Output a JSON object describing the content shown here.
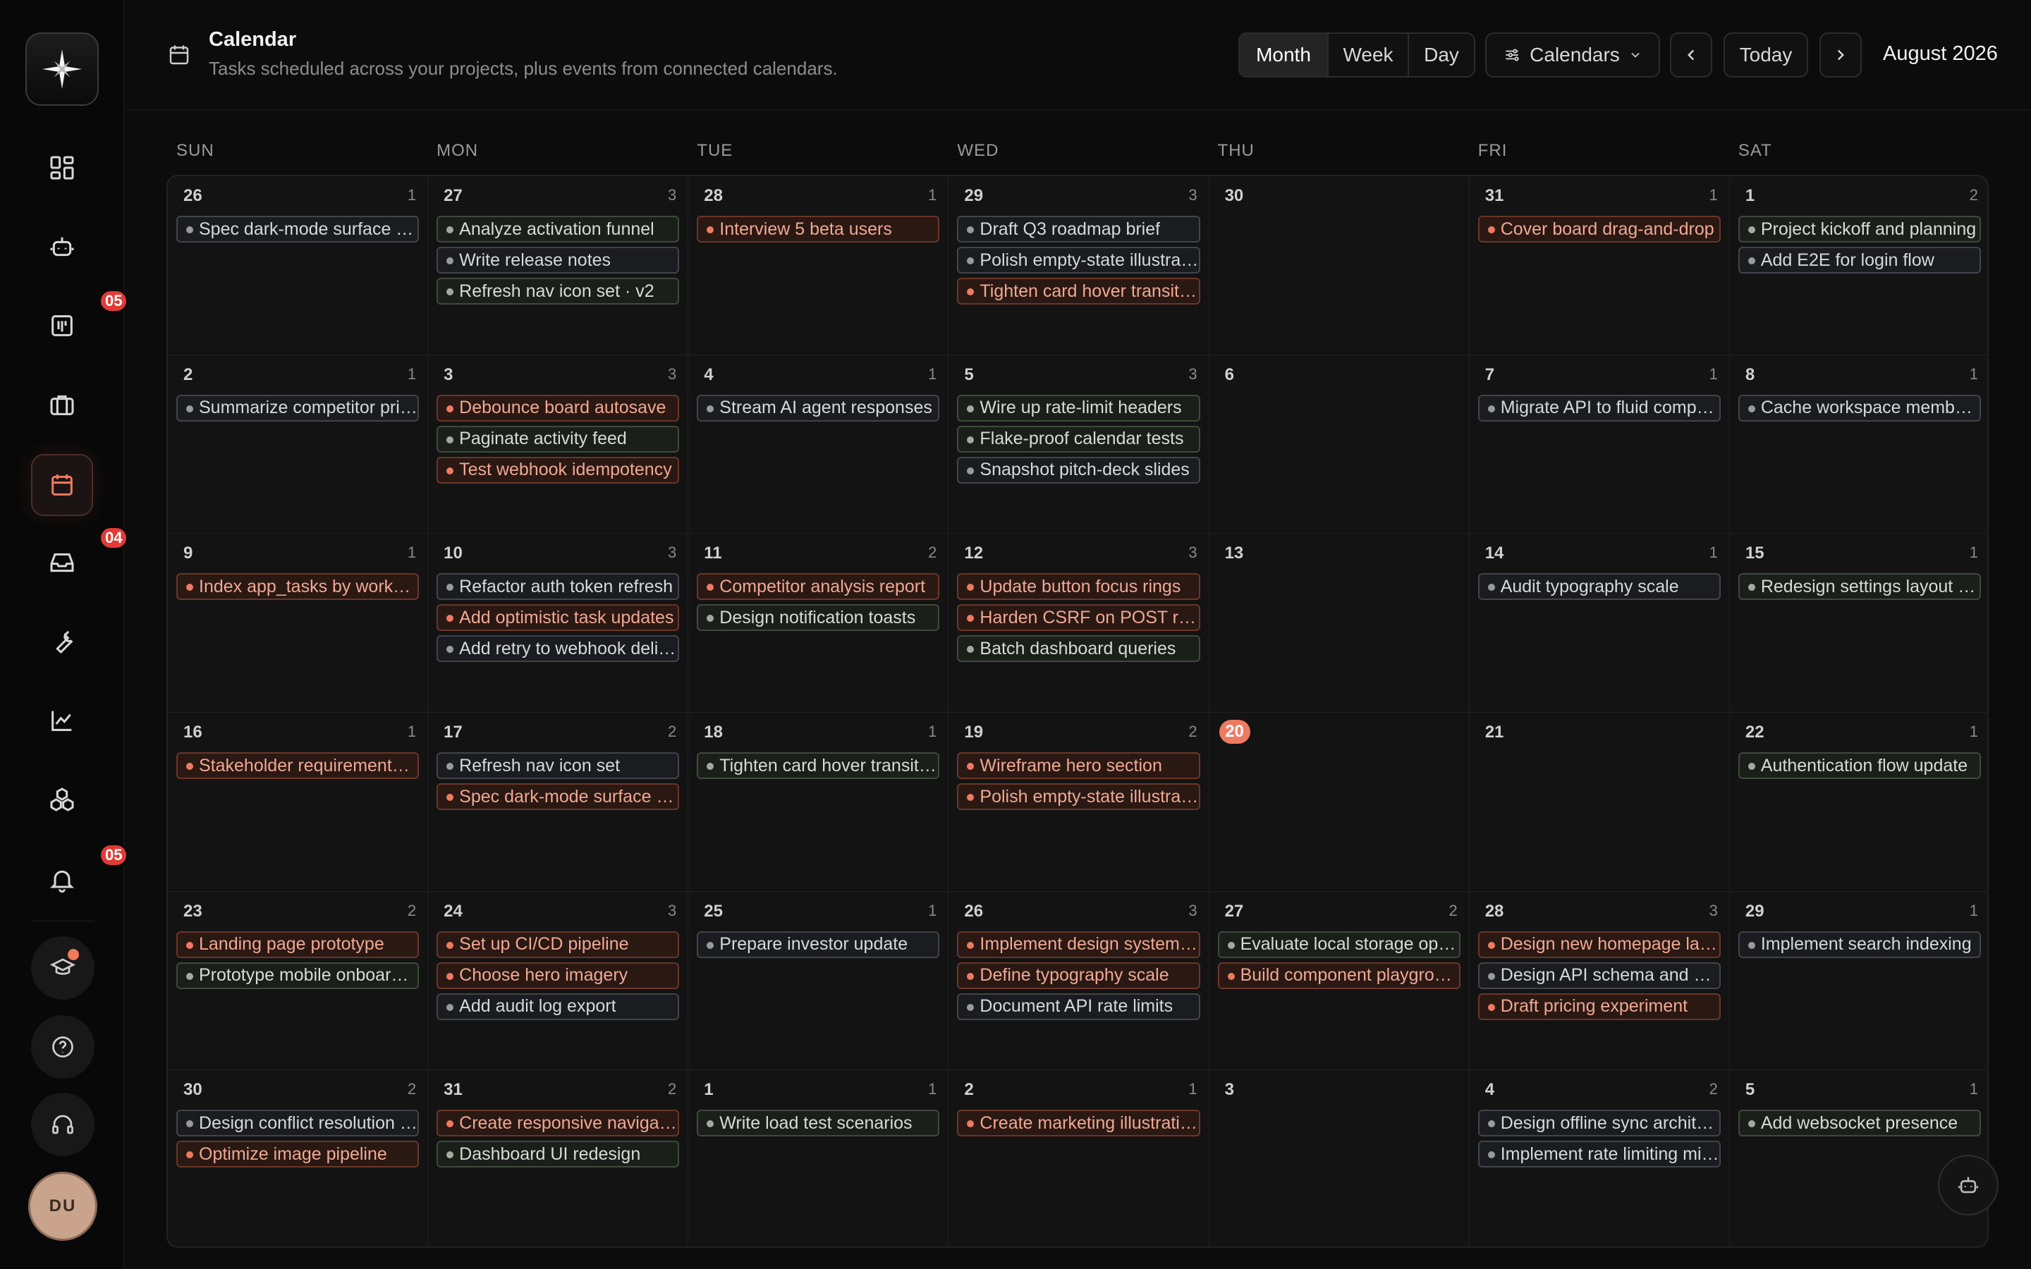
{
  "sidebar": {
    "logo_icon": "sparkle-logo-icon",
    "items": [
      {
        "name": "dashboard",
        "icon": "grid-icon",
        "badge": ""
      },
      {
        "name": "agents",
        "icon": "bot-icon",
        "badge": ""
      },
      {
        "name": "boards",
        "icon": "kanban-icon",
        "badge": "05"
      },
      {
        "name": "projects",
        "icon": "briefcase-icon",
        "badge": ""
      },
      {
        "name": "calendar",
        "icon": "calendar-icon",
        "badge": "",
        "active": true
      },
      {
        "name": "inbox",
        "icon": "inbox-icon",
        "badge": "04"
      },
      {
        "name": "tools",
        "icon": "wrench-icon",
        "badge": ""
      },
      {
        "name": "analytics",
        "icon": "chart-icon",
        "badge": ""
      },
      {
        "name": "integrations",
        "icon": "cubes-icon",
        "badge": ""
      },
      {
        "name": "notifications",
        "icon": "bell-icon",
        "badge": "05"
      }
    ],
    "avatar_initials": "DU"
  },
  "header": {
    "title": "Calendar",
    "subtitle": "Tasks scheduled across your projects, plus events from connected calendars.",
    "views": [
      "Month",
      "Week",
      "Day"
    ],
    "active_view": "Month",
    "calendars_label": "Calendars",
    "today_label": "Today",
    "month_label": "August 2026"
  },
  "weekdays": [
    "SUN",
    "MON",
    "TUE",
    "WED",
    "THU",
    "FRI",
    "SAT"
  ],
  "weeks": [
    [
      {
        "day": "26",
        "count": "1",
        "events": [
          {
            "t": "Spec dark-mode surface tokens",
            "c": "gray"
          }
        ]
      },
      {
        "day": "27",
        "count": "3",
        "events": [
          {
            "t": "Analyze activation funnel",
            "c": "green"
          },
          {
            "t": "Write release notes",
            "c": "gray"
          },
          {
            "t": "Refresh nav icon set · v2",
            "c": "green"
          }
        ]
      },
      {
        "day": "28",
        "count": "1",
        "events": [
          {
            "t": "Interview 5 beta users",
            "c": "red"
          }
        ]
      },
      {
        "day": "29",
        "count": "3",
        "events": [
          {
            "t": "Draft Q3 roadmap brief",
            "c": "gray"
          },
          {
            "t": "Polish empty-state illustrations",
            "c": "gray"
          },
          {
            "t": "Tighten card hover transitions",
            "c": "red"
          }
        ]
      },
      {
        "day": "30",
        "count": "",
        "events": []
      },
      {
        "day": "31",
        "count": "1",
        "events": [
          {
            "t": "Cover board drag-and-drop",
            "c": "red"
          }
        ]
      },
      {
        "day": "1",
        "count": "2",
        "events": [
          {
            "t": "Project kickoff and planning",
            "c": "green"
          },
          {
            "t": "Add E2E for login flow",
            "c": "gray"
          }
        ]
      }
    ],
    [
      {
        "day": "2",
        "count": "1",
        "events": [
          {
            "t": "Summarize competitor pricing",
            "c": "gray"
          }
        ]
      },
      {
        "day": "3",
        "count": "3",
        "events": [
          {
            "t": "Debounce board autosave",
            "c": "red"
          },
          {
            "t": "Paginate activity feed",
            "c": "green"
          },
          {
            "t": "Test webhook idempotency",
            "c": "red"
          }
        ]
      },
      {
        "day": "4",
        "count": "1",
        "events": [
          {
            "t": "Stream AI agent responses",
            "c": "gray"
          }
        ]
      },
      {
        "day": "5",
        "count": "3",
        "events": [
          {
            "t": "Wire up rate-limit headers",
            "c": "green"
          },
          {
            "t": "Flake-proof calendar tests",
            "c": "green"
          },
          {
            "t": "Snapshot pitch-deck slides",
            "c": "gray"
          }
        ]
      },
      {
        "day": "6",
        "count": "",
        "events": []
      },
      {
        "day": "7",
        "count": "1",
        "events": [
          {
            "t": "Migrate API to fluid compute",
            "c": "gray"
          }
        ]
      },
      {
        "day": "8",
        "count": "1",
        "events": [
          {
            "t": "Cache workspace member list",
            "c": "gray"
          }
        ]
      }
    ],
    [
      {
        "day": "9",
        "count": "1",
        "events": [
          {
            "t": "Index app_tasks by workspace",
            "c": "red"
          }
        ]
      },
      {
        "day": "10",
        "count": "3",
        "events": [
          {
            "t": "Refactor auth token refresh",
            "c": "gray"
          },
          {
            "t": "Add optimistic task updates",
            "c": "red"
          },
          {
            "t": "Add retry to webhook delivery",
            "c": "gray"
          }
        ]
      },
      {
        "day": "11",
        "count": "2",
        "events": [
          {
            "t": "Competitor analysis report",
            "c": "red"
          },
          {
            "t": "Design notification toasts",
            "c": "green"
          }
        ]
      },
      {
        "day": "12",
        "count": "3",
        "events": [
          {
            "t": "Update button focus rings",
            "c": "red"
          },
          {
            "t": "Harden CSRF on POST routes",
            "c": "red"
          },
          {
            "t": "Batch dashboard queries",
            "c": "green"
          }
        ]
      },
      {
        "day": "13",
        "count": "",
        "events": []
      },
      {
        "day": "14",
        "count": "1",
        "events": [
          {
            "t": "Audit typography scale",
            "c": "gray"
          }
        ]
      },
      {
        "day": "15",
        "count": "1",
        "events": [
          {
            "t": "Redesign settings layout grid",
            "c": "green"
          }
        ]
      }
    ],
    [
      {
        "day": "16",
        "count": "1",
        "events": [
          {
            "t": "Stakeholder requirements review",
            "c": "red"
          }
        ]
      },
      {
        "day": "17",
        "count": "2",
        "events": [
          {
            "t": "Refresh nav icon set",
            "c": "gray"
          },
          {
            "t": "Spec dark-mode surface tokens",
            "c": "red"
          }
        ]
      },
      {
        "day": "18",
        "count": "1",
        "events": [
          {
            "t": "Tighten card hover transitions",
            "c": "green"
          }
        ]
      },
      {
        "day": "19",
        "count": "2",
        "events": [
          {
            "t": "Wireframe hero section",
            "c": "red"
          },
          {
            "t": "Polish empty-state illustrations",
            "c": "red"
          }
        ]
      },
      {
        "day": "20",
        "count": "",
        "events": [],
        "today": true
      },
      {
        "day": "21",
        "count": "",
        "events": []
      },
      {
        "day": "22",
        "count": "1",
        "events": [
          {
            "t": "Authentication flow update",
            "c": "green"
          }
        ]
      }
    ],
    [
      {
        "day": "23",
        "count": "2",
        "events": [
          {
            "t": "Landing page prototype",
            "c": "red"
          },
          {
            "t": "Prototype mobile onboarding",
            "c": "green"
          }
        ]
      },
      {
        "day": "24",
        "count": "3",
        "events": [
          {
            "t": "Set up CI/CD pipeline",
            "c": "red"
          },
          {
            "t": "Choose hero imagery",
            "c": "red"
          },
          {
            "t": "Add audit log export",
            "c": "gray"
          }
        ]
      },
      {
        "day": "25",
        "count": "1",
        "events": [
          {
            "t": "Prepare investor update",
            "c": "gray"
          }
        ]
      },
      {
        "day": "26",
        "count": "3",
        "events": [
          {
            "t": "Implement design system components",
            "c": "red"
          },
          {
            "t": "Define typography scale",
            "c": "red"
          },
          {
            "t": "Document API rate limits",
            "c": "gray"
          }
        ]
      },
      {
        "day": "27",
        "count": "2",
        "events": [
          {
            "t": "Evaluate local storage options",
            "c": "green"
          },
          {
            "t": "Build component playground",
            "c": "red"
          }
        ]
      },
      {
        "day": "28",
        "count": "3",
        "events": [
          {
            "t": "Design new homepage layout",
            "c": "red"
          },
          {
            "t": "Design API schema and endpoints",
            "c": "gray"
          },
          {
            "t": "Draft pricing experiment",
            "c": "red"
          }
        ]
      },
      {
        "day": "29",
        "count": "1",
        "events": [
          {
            "t": "Implement search indexing",
            "c": "gray"
          }
        ]
      }
    ],
    [
      {
        "day": "30",
        "count": "2",
        "events": [
          {
            "t": "Design conflict resolution strategy",
            "c": "gray"
          },
          {
            "t": "Optimize image pipeline",
            "c": "red"
          }
        ]
      },
      {
        "day": "31",
        "count": "2",
        "events": [
          {
            "t": "Create responsive navigation",
            "c": "red"
          },
          {
            "t": "Dashboard UI redesign",
            "c": "green"
          }
        ]
      },
      {
        "day": "1",
        "count": "1",
        "events": [
          {
            "t": "Write load test scenarios",
            "c": "green"
          }
        ]
      },
      {
        "day": "2",
        "count": "1",
        "events": [
          {
            "t": "Create marketing illustrations",
            "c": "red"
          }
        ]
      },
      {
        "day": "3",
        "count": "",
        "events": []
      },
      {
        "day": "4",
        "count": "2",
        "events": [
          {
            "t": "Design offline sync architecture",
            "c": "gray"
          },
          {
            "t": "Implement rate limiting middleware",
            "c": "gray"
          }
        ]
      },
      {
        "day": "5",
        "count": "1",
        "events": [
          {
            "t": "Add websocket presence",
            "c": "green"
          }
        ]
      }
    ]
  ],
  "colors": {
    "accent": "#ee7a62",
    "badge": "#e23b36",
    "background": "#0c0c0c"
  },
  "fab_icon": "bot-icon"
}
